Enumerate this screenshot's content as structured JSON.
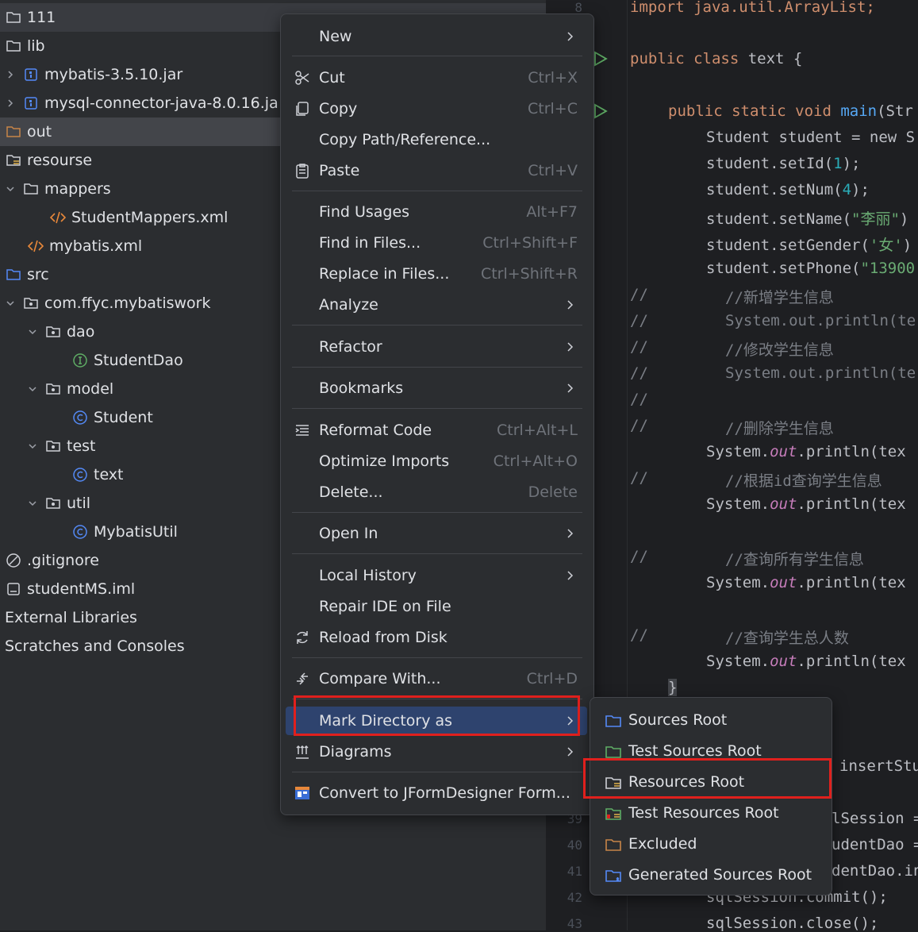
{
  "tree": {
    "items": [
      {
        "label": "111",
        "icon": "folder-icon"
      },
      {
        "label": "lib",
        "icon": "folder-icon"
      },
      {
        "label": "mybatis-3.5.10.jar",
        "icon": "jar-icon"
      },
      {
        "label": "mysql-connector-java-8.0.16.ja",
        "icon": "jar-icon"
      },
      {
        "label": "out",
        "icon": "excluded-folder-icon"
      },
      {
        "label": "resourse",
        "icon": "resources-folder-icon"
      },
      {
        "label": "mappers",
        "icon": "folder-icon"
      },
      {
        "label": "StudentMappers.xml",
        "icon": "xml-icon"
      },
      {
        "label": "mybatis.xml",
        "icon": "xml-icon"
      },
      {
        "label": "src",
        "icon": "source-folder-icon"
      },
      {
        "label": "com.ffyc.mybatiswork",
        "icon": "package-icon"
      },
      {
        "label": "dao",
        "icon": "package-icon"
      },
      {
        "label": "StudentDao",
        "icon": "interface-icon"
      },
      {
        "label": "model",
        "icon": "package-icon"
      },
      {
        "label": "Student",
        "icon": "class-icon"
      },
      {
        "label": "test",
        "icon": "package-icon"
      },
      {
        "label": "text",
        "icon": "class-icon"
      },
      {
        "label": "util",
        "icon": "package-icon"
      },
      {
        "label": "MybatisUtil",
        "icon": "class-icon"
      },
      {
        "label": ".gitignore",
        "icon": "ignore-file-icon"
      },
      {
        "label": "studentMS.iml",
        "icon": "module-file-icon"
      },
      {
        "label": "External Libraries",
        "icon": ""
      },
      {
        "label": "Scratches and Consoles",
        "icon": ""
      }
    ]
  },
  "editor": {
    "line_numbers": [
      "8",
      "39",
      "40",
      "41",
      "42",
      "43"
    ],
    "lines": {
      "l_import": "import java.util.ArrayList;",
      "l_class_kw": "public class ",
      "l_class_name": "text {",
      "l_main_kw": "public static void ",
      "l_main_fn": "main",
      "l_main_rest": "(Str",
      "l_student_new": "Student student = new S",
      "l_setid_a": "student.setId(",
      "l_setid_n": "1",
      "l_setid_b": ");",
      "l_setnum_a": "student.setNum(",
      "l_setnum_n": "4",
      "l_setnum_b": ");",
      "l_setname_a": "student.setName(",
      "l_setname_s": "\"李丽\"",
      "l_setname_b": ")",
      "l_setgender_a": "student.setGender(",
      "l_setgender_s": "'女'",
      "l_setgender_b": ")",
      "l_setphone_a": "student.setPhone(",
      "l_setphone_s": "\"13900",
      "c_add": "//新增学生信息",
      "c_print1": "System.out.println(te",
      "c_modify": "//修改学生信息",
      "c_print2": "System.out.println(te",
      "c_delete": "//删除学生信息",
      "p1_a": "System.",
      "p1_out": "out",
      "p1_b": ".println(tex",
      "c_byid": "//根据id查询学生信息",
      "p2_a": "System.",
      "p2_out": "out",
      "p2_b": ".println(tex",
      "c_all": "//查询所有学生信息",
      "p3_a": "System.",
      "p3_out": "out",
      "p3_b": ".println(tex",
      "c_count": "//查询学生总人数",
      "p4_a": "System.",
      "p4_out": "out",
      "p4_b": ".println(tex",
      "brace": "}",
      "insert": "insertStu",
      "sqlsession": "lSession =",
      "studentdao": "udentDao =",
      "dentdao": "dentDao.in",
      "commit": "sqlSession.commit();",
      "close": "sqlSession.close();"
    },
    "comment_marker": "//"
  },
  "menu": {
    "items": [
      {
        "label": "New",
        "shortcut": "",
        "submenu": true
      },
      {
        "label": "Cut",
        "shortcut": "Ctrl+X"
      },
      {
        "label": "Copy",
        "shortcut": "Ctrl+C"
      },
      {
        "label": "Copy Path/Reference...",
        "shortcut": ""
      },
      {
        "label": "Paste",
        "shortcut": "Ctrl+V"
      },
      {
        "label": "Find Usages",
        "shortcut": "Alt+F7"
      },
      {
        "label": "Find in Files...",
        "shortcut": "Ctrl+Shift+F"
      },
      {
        "label": "Replace in Files...",
        "shortcut": "Ctrl+Shift+R"
      },
      {
        "label": "Analyze",
        "shortcut": "",
        "submenu": true
      },
      {
        "label": "Refactor",
        "shortcut": "",
        "submenu": true
      },
      {
        "label": "Bookmarks",
        "shortcut": "",
        "submenu": true
      },
      {
        "label": "Reformat Code",
        "shortcut": "Ctrl+Alt+L"
      },
      {
        "label": "Optimize Imports",
        "shortcut": "Ctrl+Alt+O"
      },
      {
        "label": "Delete...",
        "shortcut": "Delete"
      },
      {
        "label": "Open In",
        "shortcut": "",
        "submenu": true
      },
      {
        "label": "Local History",
        "shortcut": "",
        "submenu": true
      },
      {
        "label": "Repair IDE on File",
        "shortcut": ""
      },
      {
        "label": "Reload from Disk",
        "shortcut": ""
      },
      {
        "label": "Compare With...",
        "shortcut": "Ctrl+D"
      },
      {
        "label": "Mark Directory as",
        "shortcut": "",
        "submenu": true
      },
      {
        "label": "Diagrams",
        "shortcut": "",
        "submenu": true
      },
      {
        "label": "Convert to JFormDesigner Form...",
        "shortcut": ""
      }
    ]
  },
  "submenu": {
    "items": [
      {
        "label": "Sources Root"
      },
      {
        "label": "Test Sources Root"
      },
      {
        "label": "Resources Root"
      },
      {
        "label": "Test Resources Root"
      },
      {
        "label": "Excluded"
      },
      {
        "label": "Generated Sources Root"
      }
    ]
  },
  "colors": {
    "highlight_border": "#e0201d",
    "menu_active": "#2e436e",
    "folder_blue": "#548af7",
    "folder_orange": "#c88548",
    "folder_green": "#5fad65"
  }
}
